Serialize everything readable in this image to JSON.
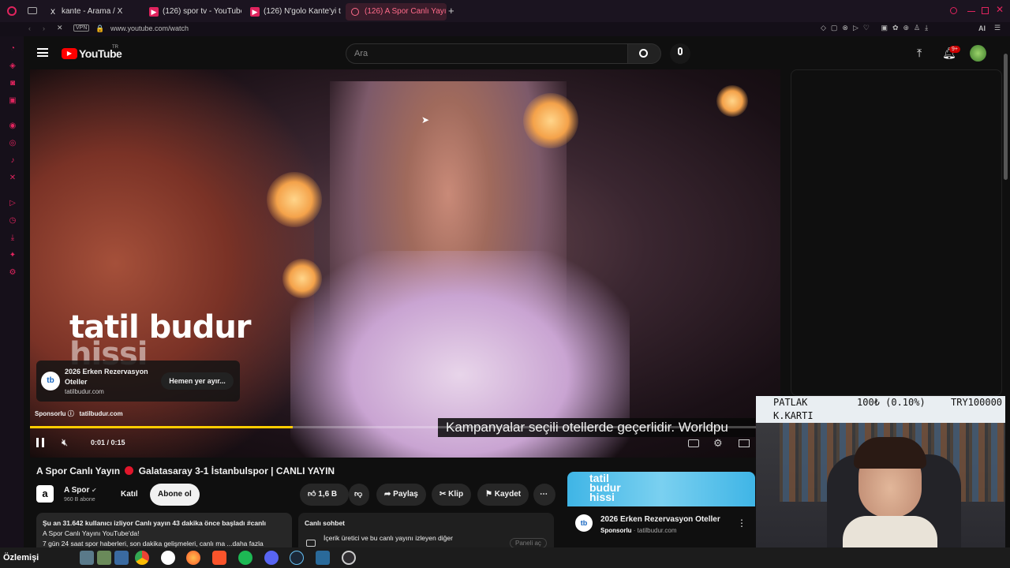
{
  "tabs": [
    {
      "label": "kante - Arama / X",
      "icon": "X"
    },
    {
      "label": "(126) spor tv - YouTube",
      "icon": "▶"
    },
    {
      "label": "(126) N'golo Kante'yi t",
      "icon": "▶"
    },
    {
      "label": "(126) A Spor Canlı Yayın",
      "icon": "◌"
    }
  ],
  "address": {
    "url": "www.youtube.com/watch",
    "vpn": "VPN",
    "ai": "AI"
  },
  "yt": {
    "logo": "YouTube",
    "region": "TR",
    "search_placeholder": "Ara",
    "notif_count": "9+"
  },
  "video": {
    "overlay_brand": "tatil budur",
    "overlay_sub": "hissi",
    "ad_title": "2026 Erken Rezervasyon Oteller",
    "ad_domain": "tatilbudur.com",
    "ad_cta": "Hemen yer ayır...",
    "sponsored": "Sponsorlu",
    "sponsored_domain": "tatilbudur.com",
    "subtitle": "Kampanyalar seçili otellerde geçerlidir. Worldpu",
    "time": "0:01 / 0:15",
    "progress": 0.35
  },
  "meta": {
    "title_prefix": "A Spor Canlı Yayın",
    "title_suffix": "Galatasaray 3-1 İstanbulspor | CANLI YAYIN",
    "channel": "A Spor",
    "subscribers": "960 B abone",
    "join": "Katıl",
    "subscribe": "Abone ol",
    "likes": "1,6 B",
    "share": "Paylaş",
    "clip": "Klip",
    "save": "Kaydet",
    "desc_line1": "Şu an 31.642 kullanıcı izliyor  Canlı yayın 43 dakika önce başladı  #canlı",
    "desc_line2": "A Spor Canlı Yayını YouTube'da!",
    "desc_line3": "7 gün 24 saat spor haberleri, son dakika gelişmeleri, canlı ma  ...daha fazla",
    "chat_title": "Canlı sohbet",
    "chat_text": "İçerik üretici ve bu canlı yayını izleyen diğer",
    "chat_btn": "Paneli aç"
  },
  "sidead": {
    "title": "2026 Erken Rezervasyon Oteller",
    "sponsored": "Sponsorlu",
    "domain": "tatilbudur.com",
    "banner": "tatil budur hissi"
  },
  "donation": {
    "line1_name": "PATLAK",
    "line1_amount": "100₺ (0.10%)",
    "line1_total": "TRY100000",
    "line2": "K.KARTI"
  },
  "taskbar": {
    "label": "Özlemişi"
  }
}
